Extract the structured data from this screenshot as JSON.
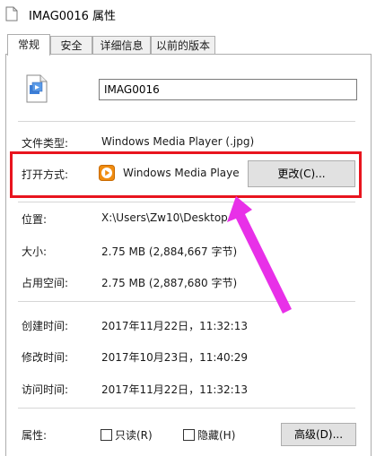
{
  "window": {
    "title": "IMAG0016 属性"
  },
  "tabs": [
    "常规",
    "安全",
    "详细信息",
    "以前的版本"
  ],
  "file": {
    "name": "IMAG0016"
  },
  "properties": {
    "type_label": "文件类型:",
    "type_value": "Windows Media Player (.jpg)",
    "open_with_label": "打开方式:",
    "open_with_value": "Windows Media Playe",
    "change_button": "更改(C)...",
    "location_label": "位置:",
    "location_value": "X:\\Users\\Zw10\\Desktop",
    "size_label": "大小:",
    "size_value": "2.75 MB (2,884,667 字节)",
    "size_on_disk_label": "占用空间:",
    "size_on_disk_value": "2.75 MB (2,887,680 字节)",
    "created_label": "创建时间:",
    "created_value": "2017年11月22日，11:32:13",
    "modified_label": "修改时间:",
    "modified_value": "2017年10月23日，11:40:29",
    "accessed_label": "访问时间:",
    "accessed_value": "2017年11月22日，11:32:13",
    "attributes_label": "属性:",
    "readonly_label": "只读(R)",
    "hidden_label": "隐藏(H)",
    "advanced_button": "高级(D)..."
  },
  "colors": {
    "highlight_box": "#e8141e",
    "arrow": "#e830e8"
  },
  "icons": {
    "title": "document-icon",
    "file": "media-file-icon",
    "open_with": "media-player-icon"
  }
}
